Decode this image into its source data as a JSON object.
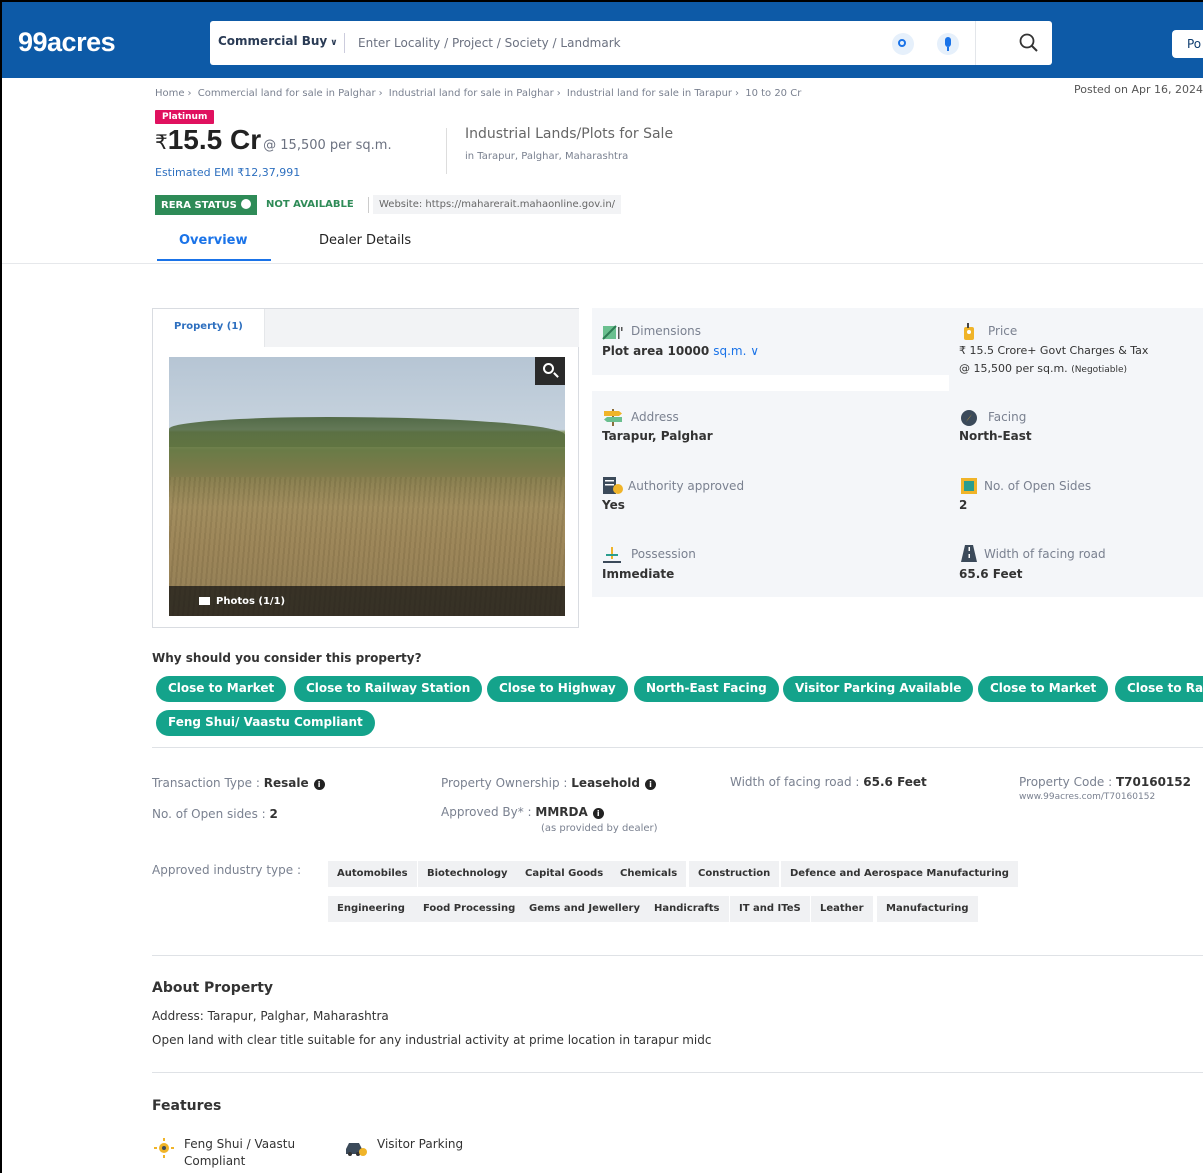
{
  "header": {
    "logo": "99acres",
    "search_type": "Commercial Buy",
    "search_placeholder": "Enter Locality / Project / Society / Landmark",
    "post_label": "Po"
  },
  "breadcrumb": [
    "Home",
    "Commercial land for sale in Palghar",
    "Industrial land for sale in Palghar",
    "Industrial land for sale in Tarapur",
    "10 to 20 Cr"
  ],
  "posted_on": "Posted on Apr 16, 2024",
  "listing": {
    "badge": "Platinum",
    "currency": "₹",
    "price": "15.5 Cr",
    "per_unit": "@ 15,500 per sq.m.",
    "emi": "Estimated EMI ₹12,37,991",
    "title": "Industrial Lands/Plots for Sale",
    "location": "in Tarapur, Palghar, Maharashtra",
    "rera_status": "RERA STATUS",
    "rera_value": "NOT AVAILABLE",
    "rera_website": "Website: https://maharerait.mahaonline.gov.in/"
  },
  "tabs": {
    "overview": "Overview",
    "dealer": "Dealer Details"
  },
  "photos": {
    "tab_label": "Property (1)",
    "count": "Photos (1/1)"
  },
  "details": {
    "dimensions": {
      "label": "Dimensions",
      "value": "Plot area 10000",
      "unit": "sq.m."
    },
    "price": {
      "label": "Price",
      "value": "₹ 15.5 Crore+ Govt Charges & Tax",
      "sub": "@ 15,500 per sq.m.",
      "sub_note": "(Negotiable)"
    },
    "address": {
      "label": "Address",
      "value": "Tarapur, Palghar"
    },
    "facing": {
      "label": "Facing",
      "value": "North-East"
    },
    "authority": {
      "label": "Authority approved",
      "value": "Yes"
    },
    "open_sides": {
      "label": "No. of Open Sides",
      "value": "2"
    },
    "possession": {
      "label": "Possession",
      "value": "Immediate"
    },
    "road_width": {
      "label": "Width of facing road",
      "value": "65.6 Feet"
    }
  },
  "why": {
    "title": "Why should you consider this property?",
    "chips": [
      "Close to Market",
      "Close to Railway Station",
      "Close to Highway",
      "North-East Facing",
      "Visitor Parking Available",
      "Close to Market",
      "Close to Rai",
      "Feng Shui/ Vaastu Compliant"
    ]
  },
  "info": {
    "transaction_label": "Transaction Type :",
    "transaction_value": "Resale",
    "ownership_label": "Property Ownership :",
    "ownership_value": "Leasehold",
    "road_label": "Width of facing road :",
    "road_value": "65.6 Feet",
    "code_label": "Property Code :",
    "code_value": "T70160152",
    "code_url": "www.99acres.com/T70160152",
    "open_sides_label": "No. of Open sides :",
    "open_sides_value": "2",
    "approved_label": "Approved By* :",
    "approved_value": "MMRDA",
    "approved_note": "(as provided by dealer)",
    "industry_label": "Approved industry type :",
    "industries": [
      "Automobiles",
      "Biotechnology",
      "Capital Goods",
      "Chemicals",
      "Construction",
      "Defence and Aerospace Manufacturing",
      "Engineering",
      "Food Processing",
      "Gems and Jewellery",
      "Handicrafts",
      "IT and ITeS",
      "Leather",
      "Manufacturing"
    ]
  },
  "about": {
    "title": "About Property",
    "address": "Address: Tarapur, Palghar, Maharashtra",
    "description": "Open land with clear title suitable for any industrial activity at prime location in tarapur midc"
  },
  "features": {
    "title": "Features",
    "items": [
      "Feng Shui / Vaastu",
      "Compliant",
      "Visitor Parking"
    ]
  },
  "colors": {
    "brand": "#0d5aa7",
    "chip": "#14a38b",
    "platinum": "#e0115f",
    "rera": "#2e8b57",
    "link": "#1a73e8"
  }
}
